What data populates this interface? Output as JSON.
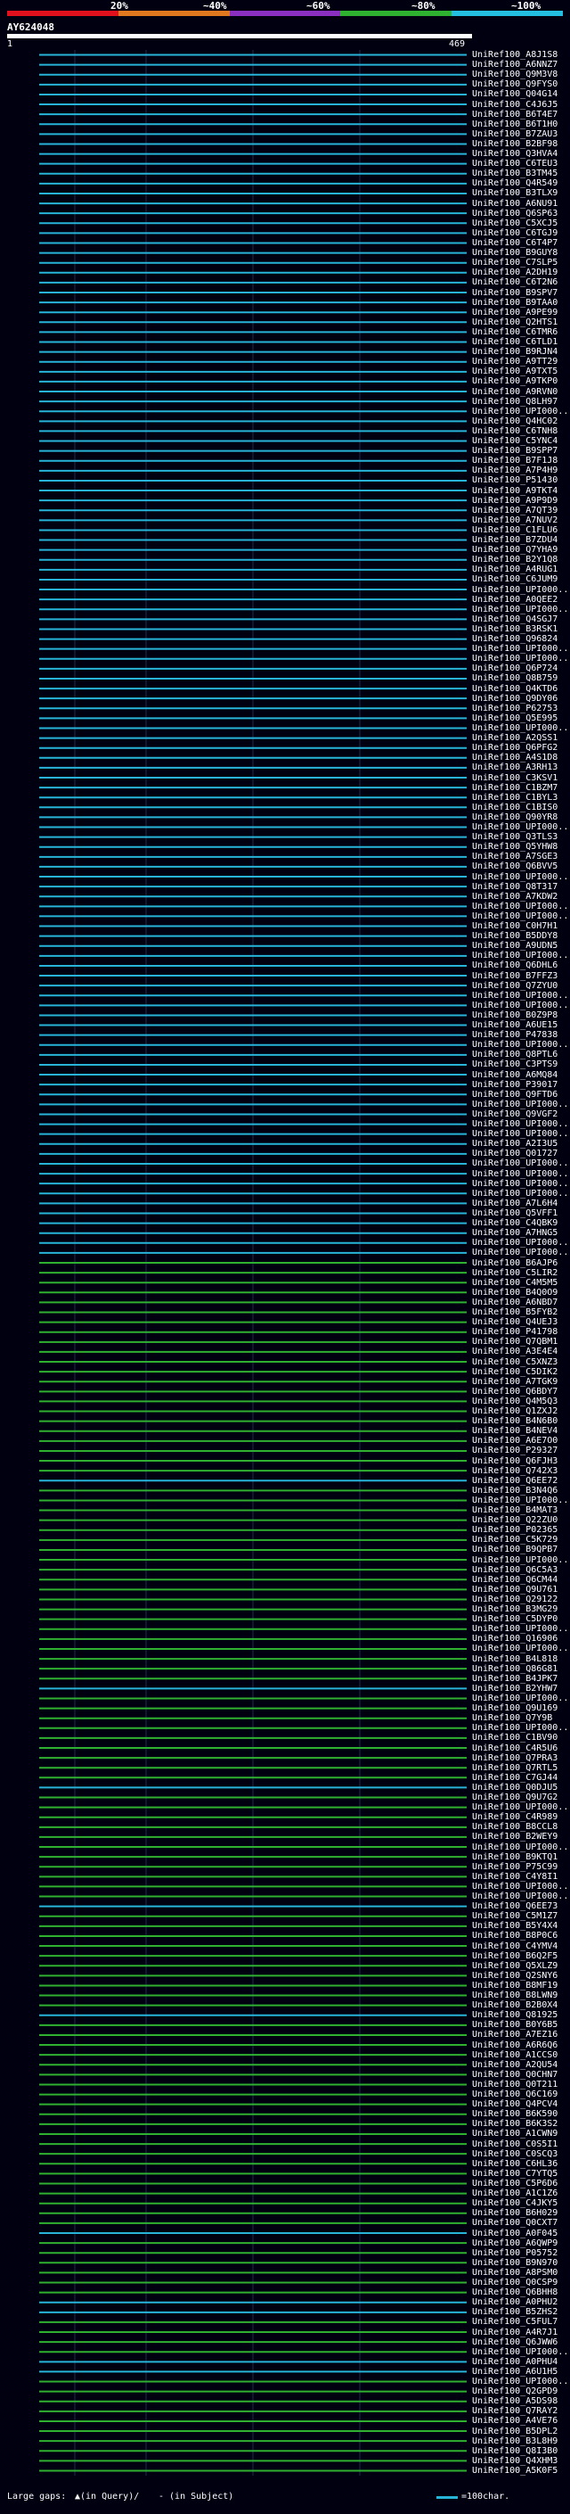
{
  "legend": {
    "labels": [
      "20%",
      "~40%",
      "~60%",
      "~80%",
      "~100%"
    ],
    "colors": [
      "#e0101c",
      "#e07820",
      "#8a2fbf",
      "#2fb22f",
      "#24bfe0"
    ]
  },
  "query": {
    "title": "AY624048",
    "start": "1",
    "end": "469"
  },
  "colors": {
    "cyan": "#27b4d8",
    "green": "#30b030",
    "dark": "#101820",
    "grid": "#1a3050"
  },
  "rows": [
    {
      "label": "UniRef100_A8J1S8",
      "c": "cyan"
    },
    {
      "label": "UniRef100_A6NNZ7",
      "c": "cyan"
    },
    {
      "label": "UniRef100_Q9M3V8",
      "c": "cyan"
    },
    {
      "label": "UniRef100_Q9FYS0",
      "c": "cyan"
    },
    {
      "label": "UniRef100_Q04G14",
      "c": "cyan"
    },
    {
      "label": "UniRef100_C4J6J5",
      "c": "cyan"
    },
    {
      "label": "UniRef100_B6T4E7",
      "c": "cyan"
    },
    {
      "label": "UniRef100_B6T1H0",
      "c": "cyan"
    },
    {
      "label": "UniRef100_B7ZAU3",
      "c": "cyan"
    },
    {
      "label": "UniRef100_B2BF98",
      "c": "cyan"
    },
    {
      "label": "UniRef100_Q3HVA4",
      "c": "cyan"
    },
    {
      "label": "UniRef100_C6TEU3",
      "c": "cyan"
    },
    {
      "label": "UniRef100_B3TM45",
      "c": "cyan"
    },
    {
      "label": "UniRef100_Q4R549",
      "c": "cyan"
    },
    {
      "label": "UniRef100_B3TLX9",
      "c": "cyan"
    },
    {
      "label": "UniRef100_A6NU91",
      "c": "cyan"
    },
    {
      "label": "UniRef100_Q6SP63",
      "c": "cyan"
    },
    {
      "label": "UniRef100_C5XCJ5",
      "c": "cyan"
    },
    {
      "label": "UniRef100_C6TGJ9",
      "c": "cyan"
    },
    {
      "label": "UniRef100_C6T4P7",
      "c": "cyan"
    },
    {
      "label": "UniRef100_B9GUY8",
      "c": "cyan"
    },
    {
      "label": "UniRef100_C7SLP5",
      "c": "cyan"
    },
    {
      "label": "UniRef100_A2DH19",
      "c": "cyan"
    },
    {
      "label": "UniRef100_C6T2N6",
      "c": "cyan"
    },
    {
      "label": "UniRef100_B9SPV7",
      "c": "cyan"
    },
    {
      "label": "UniRef100_B9TAA0",
      "c": "cyan"
    },
    {
      "label": "UniRef100_A9PE99",
      "c": "cyan"
    },
    {
      "label": "UniRef100_Q2HTS1",
      "c": "cyan"
    },
    {
      "label": "UniRef100_C6TMR6",
      "c": "cyan"
    },
    {
      "label": "UniRef100_C6TLD1",
      "c": "cyan"
    },
    {
      "label": "UniRef100_B9RJN4",
      "c": "cyan"
    },
    {
      "label": "UniRef100_A9TT29",
      "c": "cyan"
    },
    {
      "label": "UniRef100_A9TXT5",
      "c": "cyan"
    },
    {
      "label": "UniRef100_A9TKP0",
      "c": "cyan"
    },
    {
      "label": "UniRef100_A9RVN0",
      "c": "cyan"
    },
    {
      "label": "UniRef100_Q8LH97",
      "c": "cyan"
    },
    {
      "label": "UniRef100_UPI000...",
      "c": "cyan"
    },
    {
      "label": "UniRef100_Q4HC02",
      "c": "cyan"
    },
    {
      "label": "UniRef100_C6TNH8",
      "c": "cyan"
    },
    {
      "label": "UniRef100_C5YNC4",
      "c": "cyan"
    },
    {
      "label": "UniRef100_B9SPP7",
      "c": "cyan"
    },
    {
      "label": "UniRef100_B7F1J8",
      "c": "cyan"
    },
    {
      "label": "UniRef100_A7P4H9",
      "c": "cyan"
    },
    {
      "label": "UniRef100_P51430",
      "c": "cyan"
    },
    {
      "label": "UniRef100_A9TKT4",
      "c": "cyan"
    },
    {
      "label": "UniRef100_A9P9D9",
      "c": "cyan"
    },
    {
      "label": "UniRef100_A7QT39",
      "c": "cyan"
    },
    {
      "label": "UniRef100_A7NUV2",
      "c": "cyan"
    },
    {
      "label": "UniRef100_C1FLU6",
      "c": "cyan"
    },
    {
      "label": "UniRef100_B7ZDU4",
      "c": "cyan"
    },
    {
      "label": "UniRef100_Q7YHA9",
      "c": "cyan"
    },
    {
      "label": "UniRef100_B2Y1Q8",
      "c": "cyan"
    },
    {
      "label": "UniRef100_A4RUG1",
      "c": "cyan"
    },
    {
      "label": "UniRef100_C6JUM9",
      "c": "cyan"
    },
    {
      "label": "UniRef100_UPI000...",
      "c": "cyan"
    },
    {
      "label": "UniRef100_A0QEE2",
      "c": "cyan"
    },
    {
      "label": "UniRef100_UPI000...",
      "c": "cyan"
    },
    {
      "label": "UniRef100_Q4SGJ7",
      "c": "cyan"
    },
    {
      "label": "UniRef100_B3RSK1",
      "c": "cyan"
    },
    {
      "label": "UniRef100_Q96824",
      "c": "cyan"
    },
    {
      "label": "UniRef100_UPI000...",
      "c": "cyan"
    },
    {
      "label": "UniRef100_UPI000...",
      "c": "cyan"
    },
    {
      "label": "UniRef100_Q6P724",
      "c": "cyan"
    },
    {
      "label": "UniRef100_Q8B759",
      "c": "cyan"
    },
    {
      "label": "UniRef100_Q4KTD6",
      "c": "cyan"
    },
    {
      "label": "UniRef100_Q9DY06",
      "c": "cyan"
    },
    {
      "label": "UniRef100_P62753",
      "c": "cyan"
    },
    {
      "label": "UniRef100_Q5E995",
      "c": "cyan"
    },
    {
      "label": "UniRef100_UPI000...",
      "c": "cyan"
    },
    {
      "label": "UniRef100_A2QSS1",
      "c": "cyan"
    },
    {
      "label": "UniRef100_Q6PFG2",
      "c": "cyan"
    },
    {
      "label": "UniRef100_A4S1D8",
      "c": "cyan"
    },
    {
      "label": "UniRef100_A3RH13",
      "c": "cyan"
    },
    {
      "label": "UniRef100_C3KSV1",
      "c": "cyan"
    },
    {
      "label": "UniRef100_C1BZM7",
      "c": "cyan"
    },
    {
      "label": "UniRef100_C1BYL3",
      "c": "cyan"
    },
    {
      "label": "UniRef100_C1BIS0",
      "c": "cyan"
    },
    {
      "label": "UniRef100_Q90YR8",
      "c": "cyan"
    },
    {
      "label": "UniRef100_UPI000...",
      "c": "cyan"
    },
    {
      "label": "UniRef100_Q3TLS3",
      "c": "cyan"
    },
    {
      "label": "UniRef100_Q5YHW8",
      "c": "cyan"
    },
    {
      "label": "UniRef100_A7SGE3",
      "c": "cyan"
    },
    {
      "label": "UniRef100_Q6BVV5",
      "c": "cyan"
    },
    {
      "label": "UniRef100_UPI000...",
      "c": "cyan"
    },
    {
      "label": "UniRef100_Q8T317",
      "c": "cyan"
    },
    {
      "label": "UniRef100_A7KDW2",
      "c": "cyan"
    },
    {
      "label": "UniRef100_UPI000...",
      "c": "cyan"
    },
    {
      "label": "UniRef100_UPI000...",
      "c": "cyan"
    },
    {
      "label": "UniRef100_C0H7H1",
      "c": "cyan"
    },
    {
      "label": "UniRef100_B5DDY8",
      "c": "cyan"
    },
    {
      "label": "UniRef100_A9UDN5",
      "c": "cyan"
    },
    {
      "label": "UniRef100_UPI000...",
      "c": "cyan"
    },
    {
      "label": "UniRef100_Q6DHL6",
      "c": "cyan"
    },
    {
      "label": "UniRef100_B7FFZ3",
      "c": "cyan"
    },
    {
      "label": "UniRef100_Q7ZYU0",
      "c": "cyan"
    },
    {
      "label": "UniRef100_UPI000...",
      "c": "cyan"
    },
    {
      "label": "UniRef100_UPI000...",
      "c": "cyan"
    },
    {
      "label": "UniRef100_B0Z9P8",
      "c": "cyan"
    },
    {
      "label": "UniRef100_A6UE15",
      "c": "cyan"
    },
    {
      "label": "UniRef100_P47838",
      "c": "cyan"
    },
    {
      "label": "UniRef100_UPI000...",
      "c": "cyan"
    },
    {
      "label": "UniRef100_Q8PTL6",
      "c": "cyan"
    },
    {
      "label": "UniRef100_C3PTS9",
      "c": "cyan"
    },
    {
      "label": "UniRef100_A6MQ84",
      "c": "cyan"
    },
    {
      "label": "UniRef100_P39017",
      "c": "cyan"
    },
    {
      "label": "UniRef100_Q9FTD6",
      "c": "cyan"
    },
    {
      "label": "UniRef100_UPI000...",
      "c": "cyan"
    },
    {
      "label": "UniRef100_Q9VGF2",
      "c": "cyan"
    },
    {
      "label": "UniRef100_UPI000...",
      "c": "cyan"
    },
    {
      "label": "UniRef100_UPI000...",
      "c": "cyan"
    },
    {
      "label": "UniRef100_A2I3U5",
      "c": "cyan"
    },
    {
      "label": "UniRef100_Q01727",
      "c": "cyan"
    },
    {
      "label": "UniRef100_UPI000...",
      "c": "cyan"
    },
    {
      "label": "UniRef100_UPI000...",
      "c": "cyan"
    },
    {
      "label": "UniRef100_UPI000...",
      "c": "cyan"
    },
    {
      "label": "UniRef100_UPI000...",
      "c": "cyan"
    },
    {
      "label": "UniRef100_A7L6H4",
      "c": "cyan"
    },
    {
      "label": "UniRef100_Q5VFF1",
      "c": "cyan"
    },
    {
      "label": "UniRef100_C4QBK9",
      "c": "cyan"
    },
    {
      "label": "UniRef100_A7HNG5",
      "c": "cyan"
    },
    {
      "label": "UniRef100_UPI000...",
      "c": "cyan"
    },
    {
      "label": "UniRef100_UPI000...",
      "c": "cyan"
    },
    {
      "label": "UniRef100_B6AJP6",
      "c": "green"
    },
    {
      "label": "UniRef100_C5LIR2",
      "c": "green"
    },
    {
      "label": "UniRef100_C4M5M5",
      "c": "green"
    },
    {
      "label": "UniRef100_B4Q0O9",
      "c": "green"
    },
    {
      "label": "UniRef100_A6NBD7",
      "c": "green"
    },
    {
      "label": "UniRef100_B5FYB2",
      "c": "green"
    },
    {
      "label": "UniRef100_Q4UEJ3",
      "c": "green"
    },
    {
      "label": "UniRef100_P41798",
      "c": "green"
    },
    {
      "label": "UniRef100_Q7QBM1",
      "c": "green"
    },
    {
      "label": "UniRef100_A3E4E4",
      "c": "green"
    },
    {
      "label": "UniRef100_C5XNZ3",
      "c": "green"
    },
    {
      "label": "UniRef100_C5DIK2",
      "c": "green"
    },
    {
      "label": "UniRef100_A7TGK9",
      "c": "green"
    },
    {
      "label": "UniRef100_Q6BDY7",
      "c": "green"
    },
    {
      "label": "UniRef100_Q4M5Q3",
      "c": "green"
    },
    {
      "label": "UniRef100_Q1ZXJ2",
      "c": "green"
    },
    {
      "label": "UniRef100_B4N6B0",
      "c": "green"
    },
    {
      "label": "UniRef100_B4NEV4",
      "c": "green"
    },
    {
      "label": "UniRef100_A6E7O0",
      "c": "green"
    },
    {
      "label": "UniRef100_P29327",
      "c": "green"
    },
    {
      "label": "UniRef100_Q6FJH3",
      "c": "green"
    },
    {
      "label": "UniRef100_Q742X3",
      "c": "green"
    },
    {
      "label": "UniRef100_Q6EE72",
      "c": "cyan"
    },
    {
      "label": "UniRef100_B3N4Q6",
      "c": "green"
    },
    {
      "label": "UniRef100_UPI000...",
      "c": "green"
    },
    {
      "label": "UniRef100_B4MAT3",
      "c": "green"
    },
    {
      "label": "UniRef100_Q22ZU0",
      "c": "green"
    },
    {
      "label": "UniRef100_P02365",
      "c": "green"
    },
    {
      "label": "UniRef100_C5K729",
      "c": "green"
    },
    {
      "label": "UniRef100_B9QPB7",
      "c": "green"
    },
    {
      "label": "UniRef100_UPI000...",
      "c": "green"
    },
    {
      "label": "UniRef100_Q6C5A3",
      "c": "green"
    },
    {
      "label": "UniRef100_Q6CM44",
      "c": "green"
    },
    {
      "label": "UniRef100_Q9U761",
      "c": "green"
    },
    {
      "label": "UniRef100_Q29122",
      "c": "green"
    },
    {
      "label": "UniRef100_B3MG29",
      "c": "green"
    },
    {
      "label": "UniRef100_C5DYP0",
      "c": "green"
    },
    {
      "label": "UniRef100_UPI000...",
      "c": "green"
    },
    {
      "label": "UniRef100_Q16906",
      "c": "green"
    },
    {
      "label": "UniRef100_UPI000...",
      "c": "green"
    },
    {
      "label": "UniRef100_B4L818",
      "c": "green"
    },
    {
      "label": "UniRef100_Q86G81",
      "c": "green"
    },
    {
      "label": "UniRef100_B4JPK7",
      "c": "green"
    },
    {
      "label": "UniRef100_B2YHW7",
      "c": "cyan"
    },
    {
      "label": "UniRef100_UPI000...",
      "c": "green"
    },
    {
      "label": "UniRef100_Q9U169",
      "c": "green"
    },
    {
      "label": "UniRef100_Q7Y9B",
      "c": "green"
    },
    {
      "label": "UniRef100_UPI000...",
      "c": "green"
    },
    {
      "label": "UniRef100_C1BV90",
      "c": "green"
    },
    {
      "label": "UniRef100_C4R5U6",
      "c": "green"
    },
    {
      "label": "UniRef100_Q7PRA3",
      "c": "green"
    },
    {
      "label": "UniRef100_Q7RTL5",
      "c": "green"
    },
    {
      "label": "UniRef100_C7GJ44",
      "c": "green"
    },
    {
      "label": "UniRef100_Q0DJU5",
      "c": "cyan"
    },
    {
      "label": "UniRef100_Q9U7G2",
      "c": "green"
    },
    {
      "label": "UniRef100_UPI000...",
      "c": "green"
    },
    {
      "label": "UniRef100_C4R989",
      "c": "green"
    },
    {
      "label": "UniRef100_B8CCL8",
      "c": "green"
    },
    {
      "label": "UniRef100_B2WEY9",
      "c": "green"
    },
    {
      "label": "UniRef100_UPI000...",
      "c": "green"
    },
    {
      "label": "UniRef100_B9KTQ1",
      "c": "green"
    },
    {
      "label": "UniRef100_P75C99",
      "c": "green"
    },
    {
      "label": "UniRef100_C4Y8I1",
      "c": "green"
    },
    {
      "label": "UniRef100_UPI000...",
      "c": "green"
    },
    {
      "label": "UniRef100_UPI000...",
      "c": "green"
    },
    {
      "label": "UniRef100_Q6EE73",
      "c": "cyan"
    },
    {
      "label": "UniRef100_C5M1Z7",
      "c": "green"
    },
    {
      "label": "UniRef100_B5Y4X4",
      "c": "green"
    },
    {
      "label": "UniRef100_B8P0C6",
      "c": "green"
    },
    {
      "label": "UniRef100_C4YMV4",
      "c": "green"
    },
    {
      "label": "UniRef100_B6Q2F5",
      "c": "green"
    },
    {
      "label": "UniRef100_Q5XLZ9",
      "c": "green"
    },
    {
      "label": "UniRef100_Q2SNY6",
      "c": "green"
    },
    {
      "label": "UniRef100_B8MF19",
      "c": "green"
    },
    {
      "label": "UniRef100_B8LWN9",
      "c": "green"
    },
    {
      "label": "UniRef100_B2B0X4",
      "c": "green"
    },
    {
      "label": "UniRef100_Q81925",
      "c": "cyan"
    },
    {
      "label": "UniRef100_B0Y6B5",
      "c": "green"
    },
    {
      "label": "UniRef100_A7EZ16",
      "c": "green"
    },
    {
      "label": "UniRef100_A6R6Q6",
      "c": "green"
    },
    {
      "label": "UniRef100_A1CCS0",
      "c": "green"
    },
    {
      "label": "UniRef100_A2QU54",
      "c": "green"
    },
    {
      "label": "UniRef100_Q0CHN7",
      "c": "green"
    },
    {
      "label": "UniRef100_Q0T211",
      "c": "green"
    },
    {
      "label": "UniRef100_Q6C169",
      "c": "green"
    },
    {
      "label": "UniRef100_Q4PCV4",
      "c": "green"
    },
    {
      "label": "UniRef100_B6K590",
      "c": "green"
    },
    {
      "label": "UniRef100_B6K3S2",
      "c": "green"
    },
    {
      "label": "UniRef100_A1CWN9",
      "c": "green"
    },
    {
      "label": "UniRef100_C0S5I1",
      "c": "green"
    },
    {
      "label": "UniRef100_C0SCQ3",
      "c": "green"
    },
    {
      "label": "UniRef100_C6HL36",
      "c": "green"
    },
    {
      "label": "UniRef100_C7YTQ5",
      "c": "green"
    },
    {
      "label": "UniRef100_C5P6D6",
      "c": "green"
    },
    {
      "label": "UniRef100_A1C1Z6",
      "c": "green"
    },
    {
      "label": "UniRef100_C4JKY5",
      "c": "green"
    },
    {
      "label": "UniRef100_B6H029",
      "c": "green"
    },
    {
      "label": "UniRef100_Q0CXT7",
      "c": "green"
    },
    {
      "label": "UniRef100_A0F045",
      "c": "cyan"
    },
    {
      "label": "UniRef100_A6QWP9",
      "c": "green"
    },
    {
      "label": "UniRef100_P05752",
      "c": "green"
    },
    {
      "label": "UniRef100_B9N970",
      "c": "green"
    },
    {
      "label": "UniRef100_A8PSM0",
      "c": "green"
    },
    {
      "label": "UniRef100_Q0CSP9",
      "c": "green"
    },
    {
      "label": "UniRef100_Q6BHH8",
      "c": "green"
    },
    {
      "label": "UniRef100_A0PHU2",
      "c": "cyan"
    },
    {
      "label": "UniRef100_B5ZHS2",
      "c": "cyan"
    },
    {
      "label": "UniRef100_C5FUL7",
      "c": "green"
    },
    {
      "label": "UniRef100_A4R7J1",
      "c": "green"
    },
    {
      "label": "UniRef100_Q6JWW6",
      "c": "green"
    },
    {
      "label": "UniRef100_UPI000...",
      "c": "green"
    },
    {
      "label": "UniRef100_A0PHU4",
      "c": "cyan"
    },
    {
      "label": "UniRef100_A6U1H5",
      "c": "cyan"
    },
    {
      "label": "UniRef100_UPI000...",
      "c": "green"
    },
    {
      "label": "UniRef100_Q2GPD9",
      "c": "green"
    },
    {
      "label": "UniRef100_A5DS98",
      "c": "green"
    },
    {
      "label": "UniRef100_Q7RAY2",
      "c": "green"
    },
    {
      "label": "UniRef100_A4VE76",
      "c": "green"
    },
    {
      "label": "UniRef100_B5DPL2",
      "c": "green"
    },
    {
      "label": "UniRef100_B3L8H9",
      "c": "green"
    },
    {
      "label": "UniRef100_Q8I3B0",
      "c": "green"
    },
    {
      "label": "UniRef100_Q4XHM3",
      "c": "green"
    },
    {
      "label": "UniRef100_A5K0F5",
      "c": "green"
    }
  ],
  "footer": {
    "gaps_label": "Large gaps:",
    "in_query": "▲(in Query)/",
    "in_subject": "- (in Subject)",
    "scale_label": "=100char."
  }
}
